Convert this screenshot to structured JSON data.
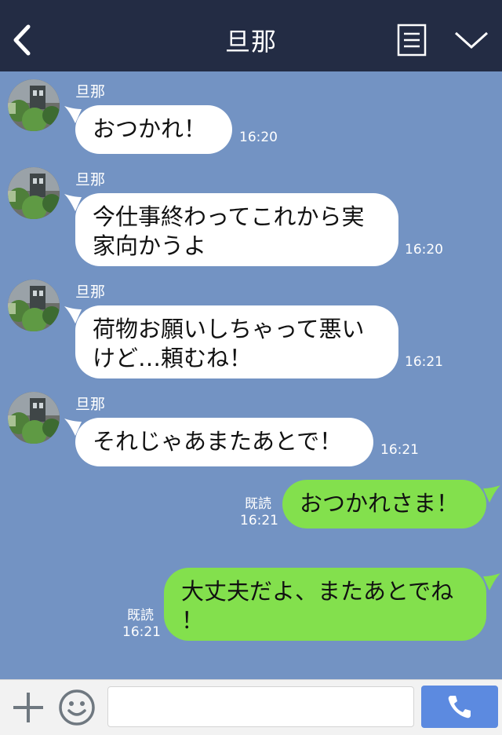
{
  "header": {
    "title": "旦那",
    "back_icon": "back-chevron-icon",
    "menu_icon": "menu-icon",
    "collapse_icon": "chevron-down-icon"
  },
  "messages": [
    {
      "direction": "incoming",
      "sender": "旦那",
      "lines": [
        "おつかれ！"
      ],
      "time": "16:20"
    },
    {
      "direction": "incoming",
      "sender": "旦那",
      "lines": [
        "今仕事終わってこれから実",
        "家向かうよ"
      ],
      "time": "16:20"
    },
    {
      "direction": "incoming",
      "sender": "旦那",
      "lines": [
        "荷物お願いしちゃって悪い",
        "けど…頼むね！"
      ],
      "time": "16:21"
    },
    {
      "direction": "incoming",
      "sender": "旦那",
      "lines": [
        "それじゃあまたあとで！"
      ],
      "time": "16:21"
    },
    {
      "direction": "outgoing",
      "read": "既読",
      "lines": [
        "おつかれさま！"
      ],
      "time": "16:21"
    },
    {
      "direction": "outgoing",
      "read": "既読",
      "lines": [
        "大丈夫だよ、またあとでね",
        "！"
      ],
      "time": "16:21"
    }
  ],
  "footer": {
    "plus_icon": "plus-icon",
    "emoji_icon": "smile-icon",
    "input_value": "",
    "call_icon": "phone-icon"
  },
  "colors": {
    "header_bg": "#232c44",
    "chat_bg": "#7393c3",
    "incoming_bubble": "#ffffff",
    "outgoing_bubble": "#83e04d",
    "call_button": "#5c8ae0"
  }
}
